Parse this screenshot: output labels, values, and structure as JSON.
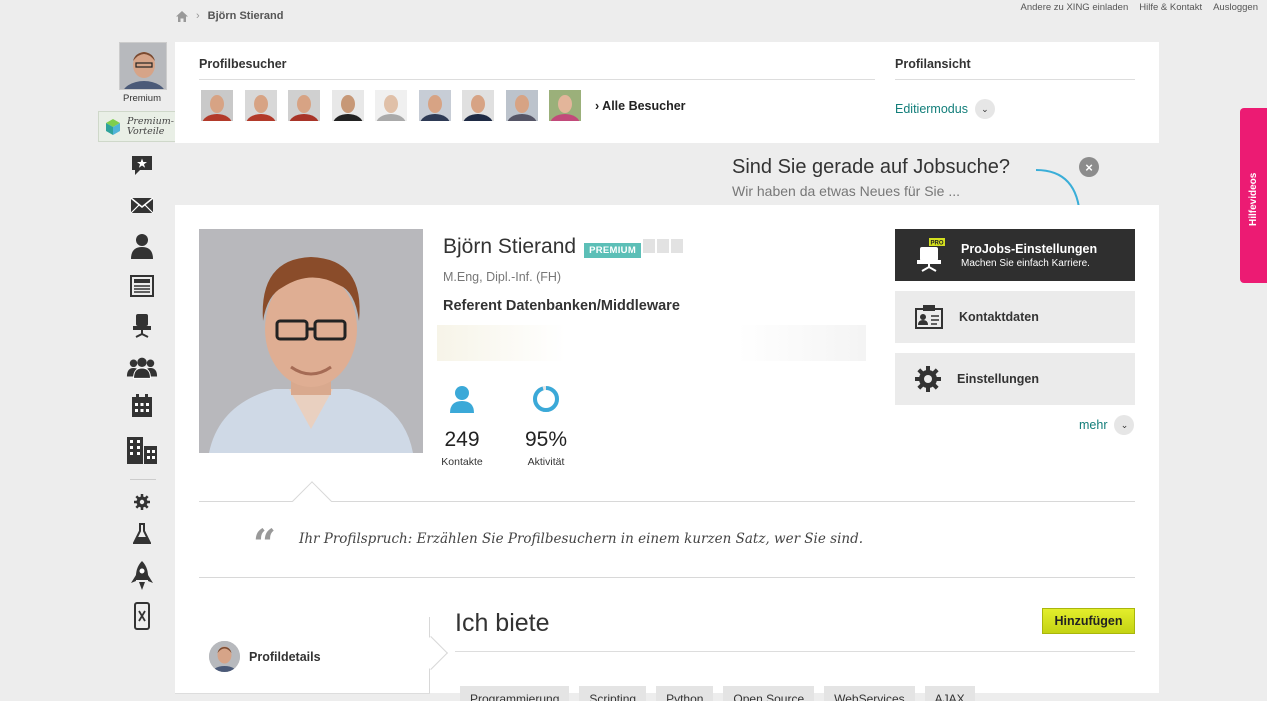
{
  "breadcrumb": {
    "current": "Björn Stierand"
  },
  "top_links": [
    "Andere zu XING einladen",
    "Hilfe & Kontakt",
    "Ausloggen"
  ],
  "sidebar": {
    "avatar_label": "Premium",
    "premium_label": "Premium-\nVorteile",
    "icons": [
      "messages-icon",
      "mail-icon",
      "contacts-icon",
      "news-icon",
      "jobs-icon",
      "groups-icon",
      "events-icon",
      "companies-icon",
      "settings-icon",
      "labs-icon",
      "rocket-icon",
      "mobile-app-icon"
    ]
  },
  "visitors": {
    "title": "Profilbesucher",
    "all_link": "Alle Besucher",
    "count": 9
  },
  "profile_view": {
    "title": "Profilansicht",
    "edit_link": "Editiermodus"
  },
  "job_banner": {
    "title": "Sind Sie gerade auf Jobsuche?",
    "subtitle": "Wir haben da etwas Neues für Sie ..."
  },
  "profile": {
    "name": "Björn Stierand",
    "badge": "PREMIUM",
    "degree": "M.Eng, Dipl.-Inf. (FH)",
    "job_title": "Referent Datenbanken/Middleware",
    "contacts_value": "249",
    "contacts_label": "Kontakte",
    "activity_value": "95%",
    "activity_label": "Aktivität",
    "activity_fraction": 0.95
  },
  "actions": {
    "projobs_title": "ProJobs-Einstellungen",
    "projobs_sub": "Machen Sie einfach Karriere.",
    "projobs_badge": "PRO",
    "contact_data": "Kontaktdaten",
    "settings": "Einstellungen",
    "more": "mehr"
  },
  "quote": {
    "mark": "“",
    "text": "Ihr Profilspruch: Erzählen Sie Profilbesuchern in einem kurzen Satz, wer Sie sind."
  },
  "tabs": {
    "profile_details": "Profildetails"
  },
  "offer": {
    "title": "Ich biete",
    "add_button": "Hinzufügen",
    "tags": [
      "Programmierung",
      "Scripting",
      "Python",
      "Open Source",
      "WebServices",
      "AJAX"
    ]
  },
  "help_tab": "Hilfevideos",
  "colors": {
    "accent_teal": "#127e7a",
    "help_pink": "#ec1b73",
    "add_green": "#d4e01f",
    "icon_blue": "#3ba9d8"
  }
}
